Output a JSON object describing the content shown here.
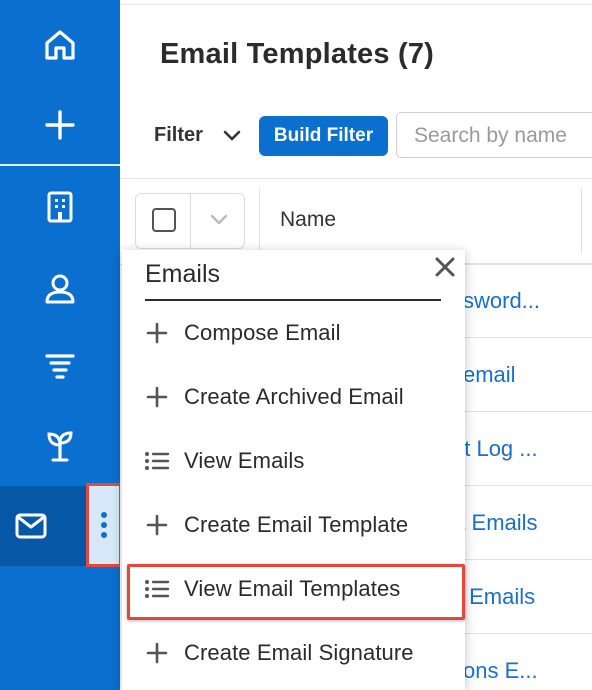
{
  "sidebar": {
    "items": [
      {
        "icon": "home-icon"
      },
      {
        "icon": "plus-icon"
      },
      {
        "icon": "building-icon"
      },
      {
        "icon": "contact-icon"
      },
      {
        "icon": "funnel-icon"
      },
      {
        "icon": "sprout-icon"
      },
      {
        "icon": "mail-icon",
        "active": true
      }
    ]
  },
  "header": {
    "title": "Email Templates (7)"
  },
  "toolbar": {
    "filter_label": "Filter",
    "build_filter_label": "Build Filter",
    "search_placeholder": "Search by name"
  },
  "table": {
    "columns": [
      "Name"
    ],
    "rows": [
      "ssword...",
      "l email",
      "nt Log ...",
      "rt Emails",
      "s Emails",
      "tions E..."
    ]
  },
  "menu": {
    "title": "Emails",
    "items": [
      {
        "label": "Compose Email",
        "icon": "plus-icon"
      },
      {
        "label": "Create Archived Email",
        "icon": "plus-icon"
      },
      {
        "label": "View Emails",
        "icon": "list-icon"
      },
      {
        "label": "Create Email Template",
        "icon": "plus-icon"
      },
      {
        "label": "View Email Templates",
        "icon": "list-icon",
        "highlighted": true
      },
      {
        "label": "Create Email Signature",
        "icon": "plus-icon"
      }
    ]
  },
  "colors": {
    "sidebar_bg": "#0a6fcf",
    "sidebar_active": "#0757a7",
    "highlight_border": "#e2483b",
    "link": "#1a6fc9"
  }
}
